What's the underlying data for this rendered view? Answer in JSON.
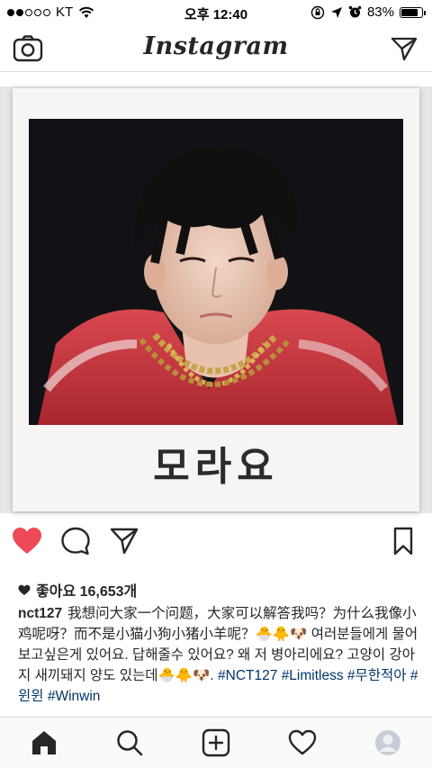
{
  "status_bar": {
    "carrier": "KT",
    "time": "오후 12:40",
    "battery": "83%",
    "battery_level": 0.83
  },
  "header": {
    "logo": "Instagram",
    "camera_icon": "camera-icon",
    "direct_icon": "paper-plane-icon"
  },
  "post": {
    "image_caption": "모라요",
    "likes_label": "좋아요 16,653개",
    "username": "nct127",
    "caption_lines": [
      "我想问大家一个问题，大家可以解答我吗？为什么我像小鸡呢呀？而不是小猫小狗小猪小羊呢？🐣🐥🐶",
      "여러분들에게 물어보고싶은게 있어요. 답해줄수 있어요? 왜 저 병아리에요? 고양이 강아지 새끼돼지 양도 있는데🐣🐥🐶."
    ],
    "hashtags": "#NCT127 #Limitless #무한적아 #윈윈 #Winwin",
    "liked": true,
    "like_color": "#ed4956"
  },
  "tab_bar": {
    "items": [
      "home-icon",
      "search-icon",
      "add-icon",
      "heart-icon",
      "profile-avatar"
    ]
  }
}
